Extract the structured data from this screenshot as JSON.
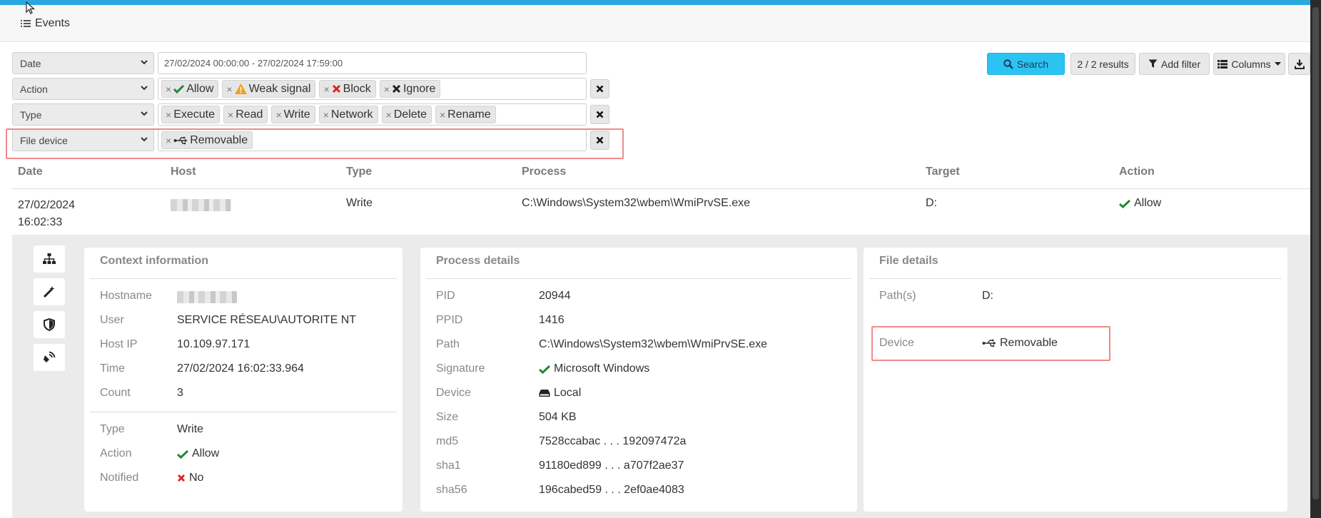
{
  "header": {
    "title": "Events"
  },
  "filters": [
    {
      "field": "Date",
      "text": "27/02/2024 00:00:00 - 27/02/2024 17:59:00"
    },
    {
      "field": "Action",
      "tags": [
        {
          "label": "Allow",
          "icon": "check-icon"
        },
        {
          "label": "Weak signal",
          "icon": "warning-icon"
        },
        {
          "label": "Block",
          "icon": "cross-icon"
        },
        {
          "label": "Ignore",
          "icon": "x-bold-icon"
        }
      ]
    },
    {
      "field": "Type",
      "tags": [
        {
          "label": "Execute"
        },
        {
          "label": "Read"
        },
        {
          "label": "Write"
        },
        {
          "label": "Network"
        },
        {
          "label": "Delete"
        },
        {
          "label": "Rename"
        }
      ]
    },
    {
      "field": "File device",
      "tags": [
        {
          "label": "Removable",
          "icon": "usb-icon"
        }
      ]
    }
  ],
  "toolbar": {
    "search_label": "Search",
    "results_label": "2 / 2 results",
    "add_filter_label": "Add filter",
    "columns_label": "Columns"
  },
  "table": {
    "headers": [
      "Date",
      "Host",
      "Type",
      "Process",
      "Target",
      "Action"
    ],
    "row": {
      "date_line1": "27/02/2024",
      "date_line2": "16:02:33",
      "type": "Write",
      "process": "C:\\Windows\\System32\\wbem\\WmiPrvSE.exe",
      "target": "D:",
      "action": "Allow"
    }
  },
  "side_icons": [
    "sitemap-icon",
    "magic-wand-icon",
    "shield-icon",
    "satellite-icon"
  ],
  "context": {
    "title": "Context information",
    "rows": [
      {
        "key": "Hostname",
        "value": ""
      },
      {
        "key": "User",
        "value": "SERVICE RÉSEAU\\AUTORITE NT"
      },
      {
        "key": "Host IP",
        "value": "10.109.97.171"
      },
      {
        "key": "Time",
        "value": "27/02/2024 16:02:33.964"
      },
      {
        "key": "Count",
        "value": "3"
      }
    ],
    "rows2": [
      {
        "key": "Type",
        "value": "Write"
      },
      {
        "key": "Action",
        "value": "Allow"
      },
      {
        "key": "Notified",
        "value": "No"
      }
    ]
  },
  "process": {
    "title": "Process details",
    "rows": [
      {
        "key": "PID",
        "value": "20944"
      },
      {
        "key": "PPID",
        "value": "1416"
      },
      {
        "key": "Path",
        "value": "C:\\Windows\\System32\\wbem\\WmiPrvSE.exe"
      },
      {
        "key": "Signature",
        "value": "Microsoft Windows"
      },
      {
        "key": "Device",
        "value": "Local"
      },
      {
        "key": "Size",
        "value": "504 KB"
      },
      {
        "key": "md5",
        "value": "7528ccabac . . . 192097472a"
      },
      {
        "key": "sha1",
        "value": "91180ed899 . . . a707f2ae37"
      },
      {
        "key": "sha56",
        "value": "196cabed59 . . . 2ef0ae4083"
      }
    ]
  },
  "file": {
    "title": "File details",
    "rows": [
      {
        "key": "Path(s)",
        "value": "D:"
      },
      {
        "key": "Device",
        "value": "Removable"
      }
    ]
  },
  "colors": {
    "accent": "#2aa9e0",
    "search": "#2bc4f2",
    "allow": "#1e8a2f",
    "block": "#e02020",
    "warning": "#f0a020",
    "highlight": "#f08a8a"
  }
}
